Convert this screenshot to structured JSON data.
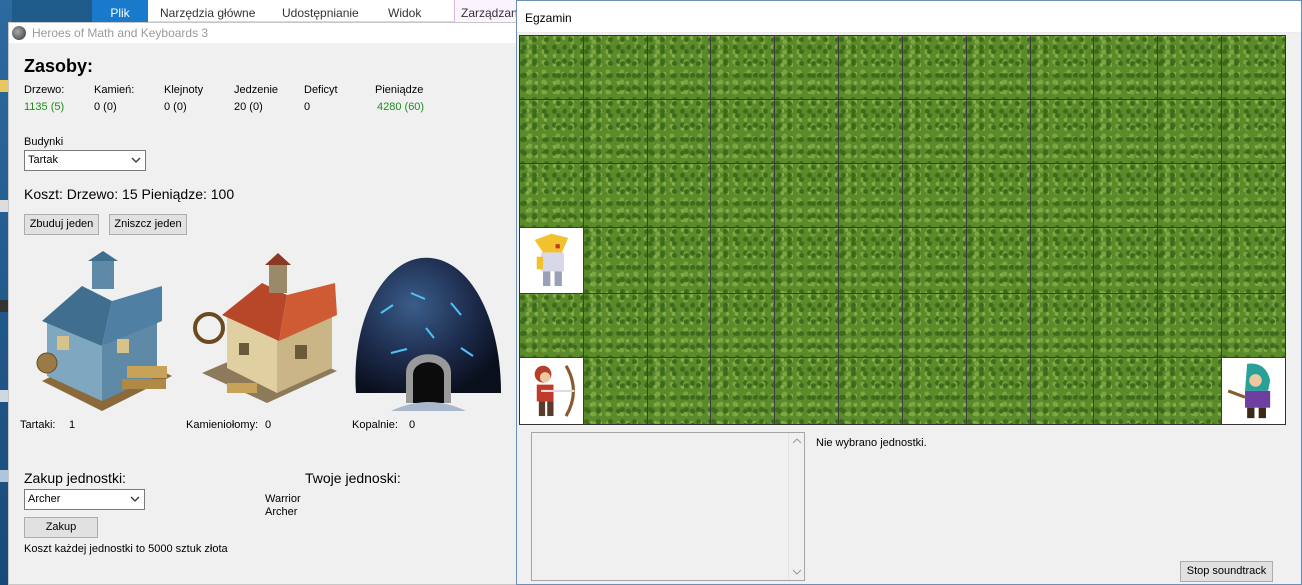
{
  "explorer": {
    "tabs": [
      "Plik",
      "Narzędzia główne",
      "Udostępnianie",
      "Widok",
      "Zarządzani"
    ]
  },
  "main_window": {
    "title": "Heroes of Math and Keyboards 3",
    "resources_heading": "Zasoby:",
    "resources": [
      {
        "label": "Drzewo:",
        "value": "1135 (5)",
        "positive": true
      },
      {
        "label": "Kamień:",
        "value": "0 (0)",
        "positive": false
      },
      {
        "label": "Klejnoty",
        "value": "0 (0)",
        "positive": false
      },
      {
        "label": "Jedzenie",
        "value": "20 (0)",
        "positive": false
      },
      {
        "label": "Deficyt",
        "value": "0",
        "positive": false
      },
      {
        "label": "Pieniądze",
        "value": "4280 (60)",
        "positive": true
      }
    ],
    "buildings_label": "Budynki",
    "building_selected": "Tartak",
    "cost_text": "Koszt: Drzewo: 15   Pieniądze: 100",
    "build_button": "Zbuduj jeden",
    "destroy_button": "Zniszcz jeden",
    "building_counts": [
      {
        "label": "Tartaki:",
        "value": "1"
      },
      {
        "label": "Kamieniołomy:",
        "value": "0"
      },
      {
        "label": "Kopalnie:",
        "value": "0"
      }
    ],
    "purchase_heading": "Zakup jednostki:",
    "unit_selected": "Archer",
    "buy_button": "Zakup",
    "unit_cost_note": "Koszt każdej jednostki to 5000 sztuk złota",
    "your_units_heading": "Twoje jednoski:",
    "your_units": [
      "Warrior",
      "Archer"
    ]
  },
  "game_window": {
    "title": "Egzamin",
    "status_text": "Nie wybrano jednostki.",
    "soundtrack_button": "Stop soundtrack"
  },
  "colors": {
    "positive_value": "#1d8e1d",
    "grass": "#5a8a2a",
    "file_tab": "#1979ca"
  }
}
